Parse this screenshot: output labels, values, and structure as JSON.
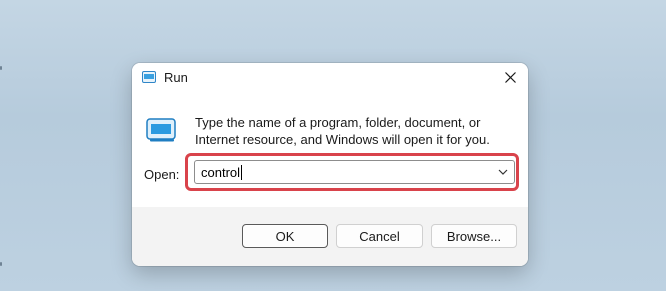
{
  "dialog": {
    "title": "Run",
    "description": "Type the name of a program, folder, document, or Internet resource, and Windows will open it for you.",
    "open_label": "Open:",
    "input_value": "control",
    "buttons": {
      "ok": "OK",
      "cancel": "Cancel",
      "browse": "Browse..."
    },
    "icons": {
      "title": "run-icon",
      "body": "run-icon",
      "close": "close-icon",
      "dropdown": "chevron-down-icon"
    }
  },
  "colors": {
    "highlight": "#d9434b",
    "dialog_bg": "#f3f3f3",
    "wallpaper": "#c4d6e4"
  }
}
